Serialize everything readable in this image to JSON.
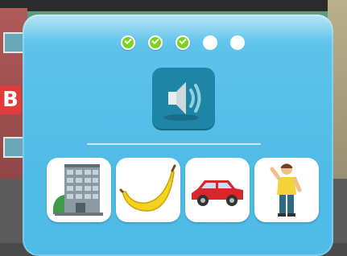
{
  "background": {
    "sign_letter": "B"
  },
  "progress": {
    "total": 5,
    "completed": 3,
    "done_color": "#7ed321",
    "todo_color": "#ffffff"
  },
  "sound_button": {
    "icon": "speaker-icon",
    "color": "#1e85a6"
  },
  "choices": [
    {
      "id": "building",
      "icon": "building-icon"
    },
    {
      "id": "banana",
      "icon": "banana-icon"
    },
    {
      "id": "car",
      "icon": "car-icon"
    },
    {
      "id": "man",
      "icon": "man-icon"
    }
  ],
  "colors": {
    "panel": "#5ec3ea",
    "card": "#ffffff"
  }
}
